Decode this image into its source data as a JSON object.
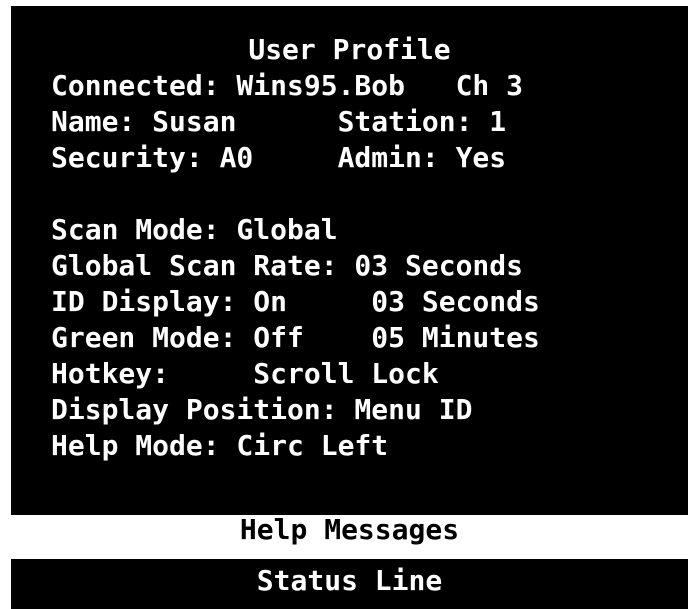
{
  "profile": {
    "title": "User Profile",
    "lines": [
      "Connected: Wins95.Bob   Ch 3",
      "Name: Susan      Station: 1",
      "Security: A0     Admin: Yes",
      "",
      "Scan Mode: Global",
      "Global Scan Rate: 03 Seconds",
      "ID Display: On     03 Seconds",
      "Green Mode: Off    05 Minutes",
      "Hotkey:     Scroll Lock",
      "Display Position: Menu ID",
      "Help Mode: Circ Left"
    ]
  },
  "footer": {
    "help_messages": "Help Messages",
    "status_line": "Status Line"
  },
  "colors": {
    "screen_bg": "#000000",
    "text": "#ffffff",
    "help_bg": "#ffffff",
    "help_text": "#000000"
  }
}
